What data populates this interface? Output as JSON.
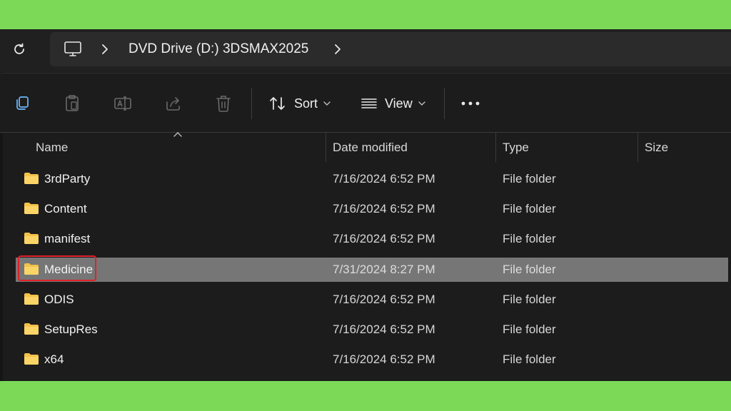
{
  "address": {
    "path_label": "DVD Drive (D:) 3DSMAX2025"
  },
  "toolbar": {
    "sort_label": "Sort",
    "view_label": "View"
  },
  "columns": {
    "name": "Name",
    "date": "Date modified",
    "type": "Type",
    "size": "Size"
  },
  "files": [
    {
      "name": "3rdParty",
      "date": "7/16/2024 6:52 PM",
      "type": "File folder"
    },
    {
      "name": "Content",
      "date": "7/16/2024 6:52 PM",
      "type": "File folder"
    },
    {
      "name": "manifest",
      "date": "7/16/2024 6:52 PM",
      "type": "File folder"
    },
    {
      "name": "Medicine",
      "date": "7/31/2024 8:27 PM",
      "type": "File folder"
    },
    {
      "name": "ODIS",
      "date": "7/16/2024 6:52 PM",
      "type": "File folder"
    },
    {
      "name": "SetupRes",
      "date": "7/16/2024 6:52 PM",
      "type": "File folder"
    },
    {
      "name": "x64",
      "date": "7/16/2024 6:52 PM",
      "type": "File folder"
    }
  ],
  "colors": {
    "background_frame": "#7bd957",
    "window": "#1c1c1c",
    "selected_row": "#767676",
    "annotation": "#e3202a",
    "folder": "#f4c24a"
  }
}
